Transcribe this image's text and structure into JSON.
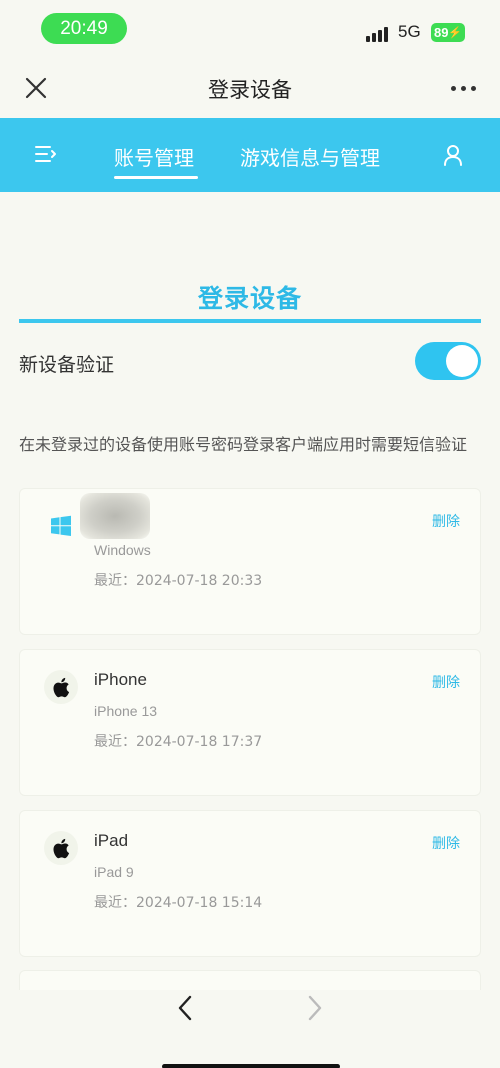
{
  "status_bar": {
    "time": "20:49",
    "network": "5G",
    "battery": "89"
  },
  "nav": {
    "title": "登录设备"
  },
  "tabs": [
    {
      "label": "账号管理",
      "active": true
    },
    {
      "label": "游戏信息与管理",
      "active": false
    }
  ],
  "section": {
    "title": "登录设备",
    "toggle_label": "新设备验证",
    "toggle_on": true,
    "description": "在未登录过的设备使用账号密码登录客户端应用时需要短信验证"
  },
  "devices": [
    {
      "name": "",
      "model": "Windows",
      "last_login": "最近：2024-07-18 20:33",
      "delete_label": "删除",
      "icon": "windows-icon"
    },
    {
      "name": "iPhone",
      "model": "iPhone 13",
      "last_login": "最近：2024-07-18 17:37",
      "delete_label": "删除",
      "icon": "apple-icon"
    },
    {
      "name": "iPad",
      "model": "iPad 9",
      "last_login": "最近：2024-07-18 15:14",
      "delete_label": "删除",
      "icon": "apple-icon"
    }
  ],
  "colors": {
    "accent": "#3cc7ee",
    "title_blue": "#2eb9e6",
    "status_green": "#3ddc53"
  }
}
